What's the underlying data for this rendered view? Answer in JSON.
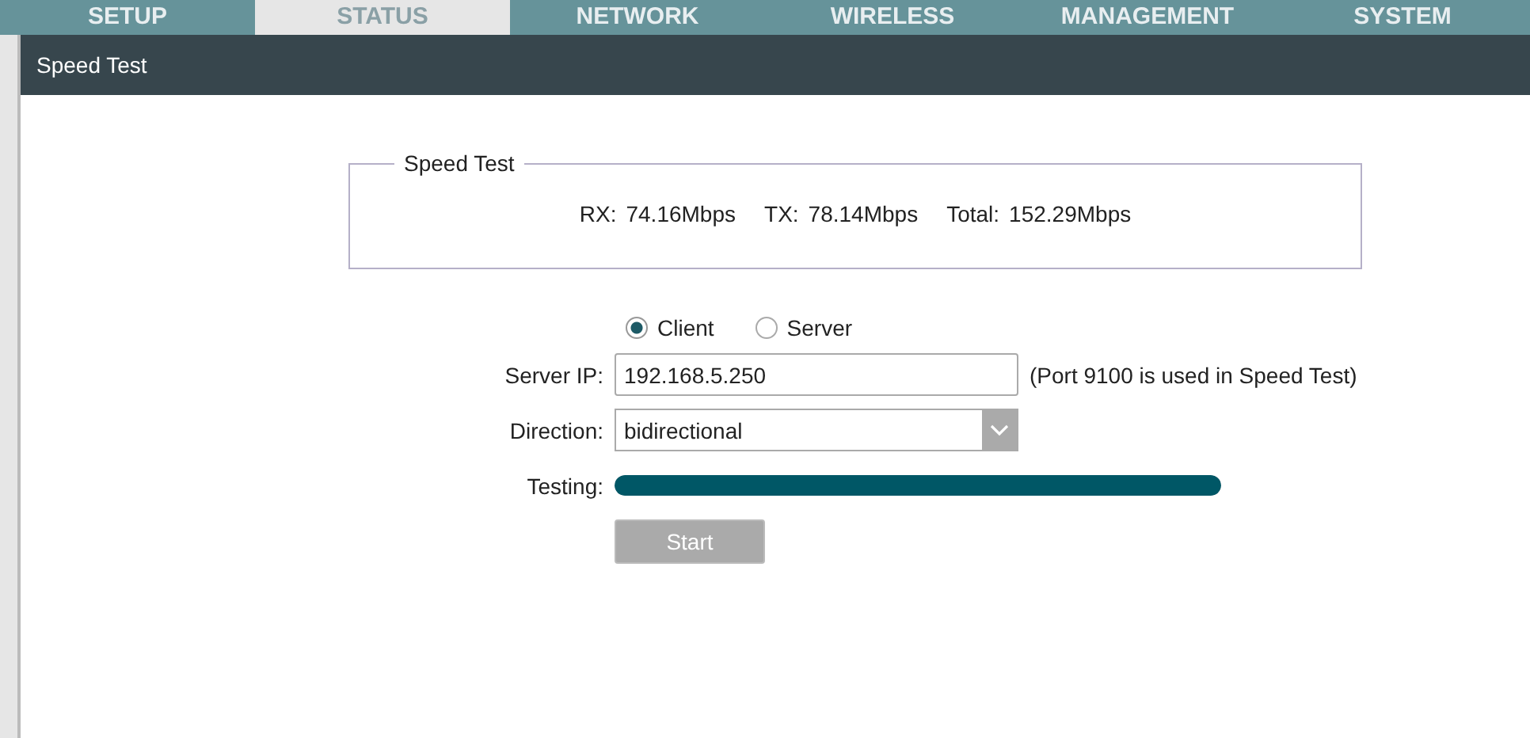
{
  "nav_tabs": [
    {
      "label": "SETUP",
      "selected": false
    },
    {
      "label": "STATUS",
      "selected": true
    },
    {
      "label": "NETWORK",
      "selected": false
    },
    {
      "label": "WIRELESS",
      "selected": false
    },
    {
      "label": "MANAGEMENT",
      "selected": false
    },
    {
      "label": "SYSTEM",
      "selected": false
    }
  ],
  "dialog": {
    "title": "Speed Test",
    "result_box": {
      "legend": "Speed Test",
      "items": [
        {
          "label": "RX:",
          "value": "74.16Mbps"
        },
        {
          "label": "TX:",
          "value": "78.14Mbps"
        },
        {
          "label": "Total:",
          "value": "152.29Mbps"
        }
      ]
    },
    "modes": [
      {
        "label": "Client",
        "selected": true
      },
      {
        "label": "Server",
        "selected": false
      }
    ],
    "server_ip": {
      "label": "Server IP:",
      "value": "192.168.5.250",
      "note": "(Port 9100 is used in Speed Test)"
    },
    "direction": {
      "label": "Direction:",
      "value": "bidirectional"
    },
    "testing": {
      "label": "Testing:",
      "level": 1
    },
    "start_button": {
      "label": "Start",
      "disabled": true
    }
  }
}
